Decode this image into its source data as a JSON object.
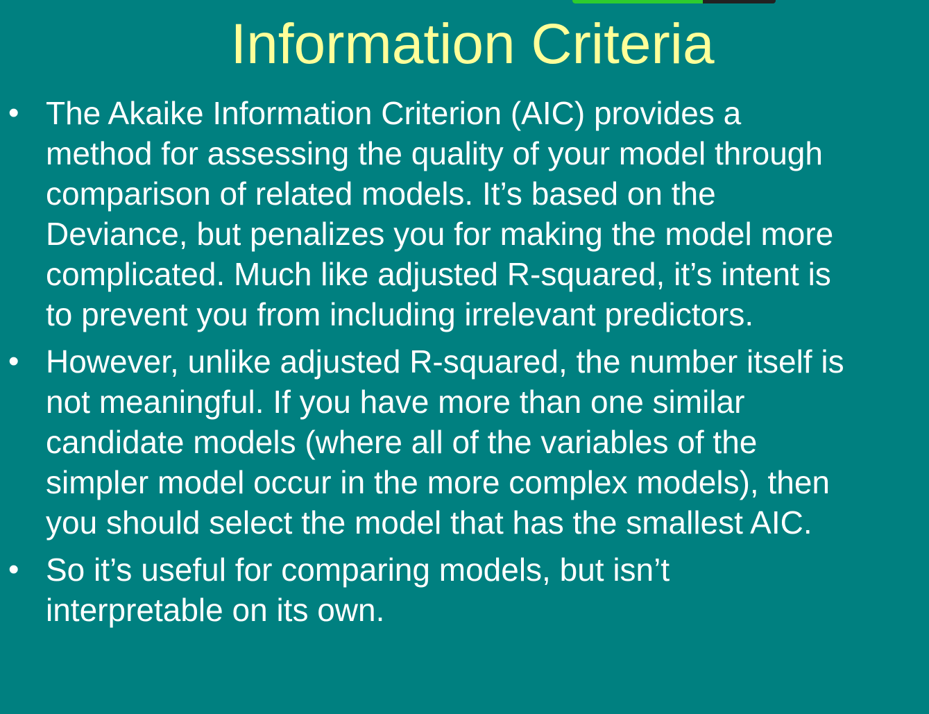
{
  "slide": {
    "title": "Information Criteria",
    "progress": 0.64,
    "colors": {
      "background": "#008080",
      "title": "#ffff99",
      "body_text": "#ffffff",
      "progress_fill": "#2ecc2e",
      "progress_track": "#222222"
    },
    "bullet_glyph": "•",
    "bullets": [
      {
        "text": "The Akaike Information Criterion (AIC) provides a\nmethod for assessing the quality of your model through\ncomparison of related models.  It’s based on the\nDeviance, but penalizes you for making the model more\ncomplicated.  Much like adjusted R-squared, it’s intent is\nto prevent you from including irrelevant predictors."
      },
      {
        "text": "However, unlike adjusted R-squared, the number itself is\nnot meaningful. If you have more than one similar\ncandidate models (where all of the variables of the\nsimpler model occur in the more complex models), then\nyou should select the model that has the smallest AIC."
      },
      {
        "text": "So it’s useful for comparing models, but isn’t\ninterpretable on its own."
      }
    ]
  }
}
